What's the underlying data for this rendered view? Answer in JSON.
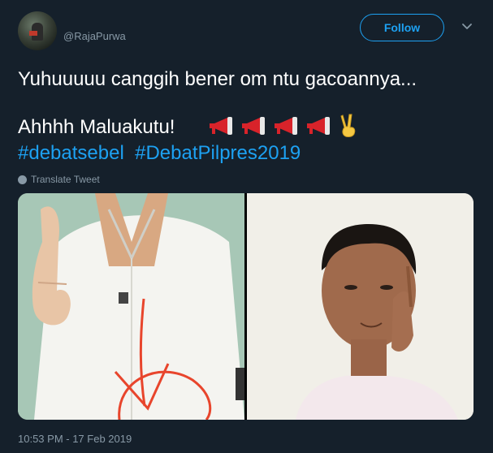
{
  "header": {
    "avatar_icon": "user-avatar",
    "handle": "@RajaPurwa",
    "follow_label": "Follow",
    "caret_icon": "chevron-down-icon"
  },
  "tweet": {
    "line1": "Yuhuuuuu canggih bener om ntu gacoannya...",
    "line2": "Ahhhh Maluakutu!",
    "emojis": [
      "megaphone",
      "megaphone",
      "megaphone",
      "megaphone",
      "victory-hand"
    ],
    "hashtags": [
      "#debatsebel",
      "#DebatPilpres2019"
    ],
    "translate_label": "Translate Tweet"
  },
  "media": {
    "images": [
      {
        "icon": "photo-shirt-closeup"
      },
      {
        "icon": "photo-man-portrait"
      }
    ]
  },
  "timestamp": "10:53 PM - 17 Feb 2019",
  "colors": {
    "background": "#15202b",
    "accent": "#1da1f2",
    "muted": "#8899a6",
    "annotation_red": "#e8452c"
  }
}
